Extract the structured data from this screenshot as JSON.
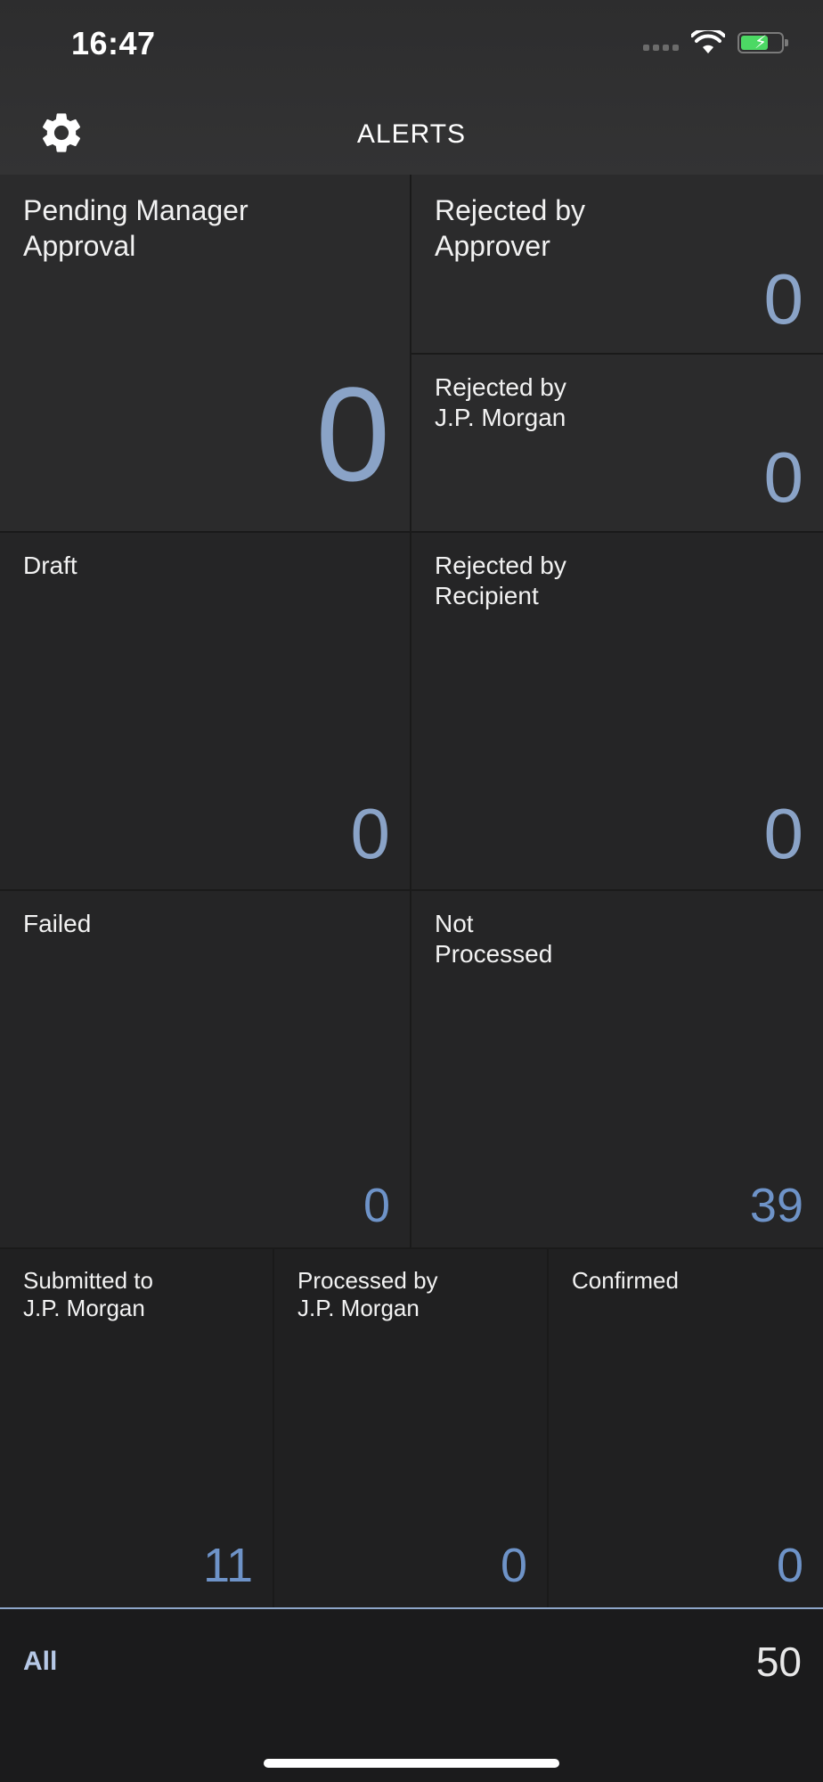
{
  "status_bar": {
    "time": "16:47"
  },
  "header": {
    "title": "ALERTS"
  },
  "tiles": {
    "pending_manager_approval": {
      "label": "Pending Manager\nApproval",
      "value": "0"
    },
    "rejected_by_approver": {
      "label": "Rejected by\nApprover",
      "value": "0"
    },
    "rejected_by_jpmorgan": {
      "label": "Rejected by\nJ.P. Morgan",
      "value": "0"
    },
    "draft": {
      "label": "Draft",
      "value": "0"
    },
    "rejected_by_recipient": {
      "label": "Rejected by\nRecipient",
      "value": "0"
    },
    "failed": {
      "label": "Failed",
      "value": "0"
    },
    "not_processed": {
      "label": "Not\nProcessed",
      "value": "39"
    },
    "submitted_to_jpmorgan": {
      "label": "Submitted to\nJ.P. Morgan",
      "value": "11"
    },
    "processed_by_jpmorgan": {
      "label": "Processed by\nJ.P. Morgan",
      "value": "0"
    },
    "confirmed": {
      "label": "Confirmed",
      "value": "0"
    }
  },
  "footer": {
    "all_label": "All",
    "all_value": "50"
  },
  "colors": {
    "value_blue": "#8aa3c7",
    "battery_green": "#4cd964",
    "accent_line": "#8ea6c9"
  },
  "icons": {
    "settings": "gear-icon",
    "wifi": "wifi-icon",
    "battery": "battery-charging-icon"
  }
}
